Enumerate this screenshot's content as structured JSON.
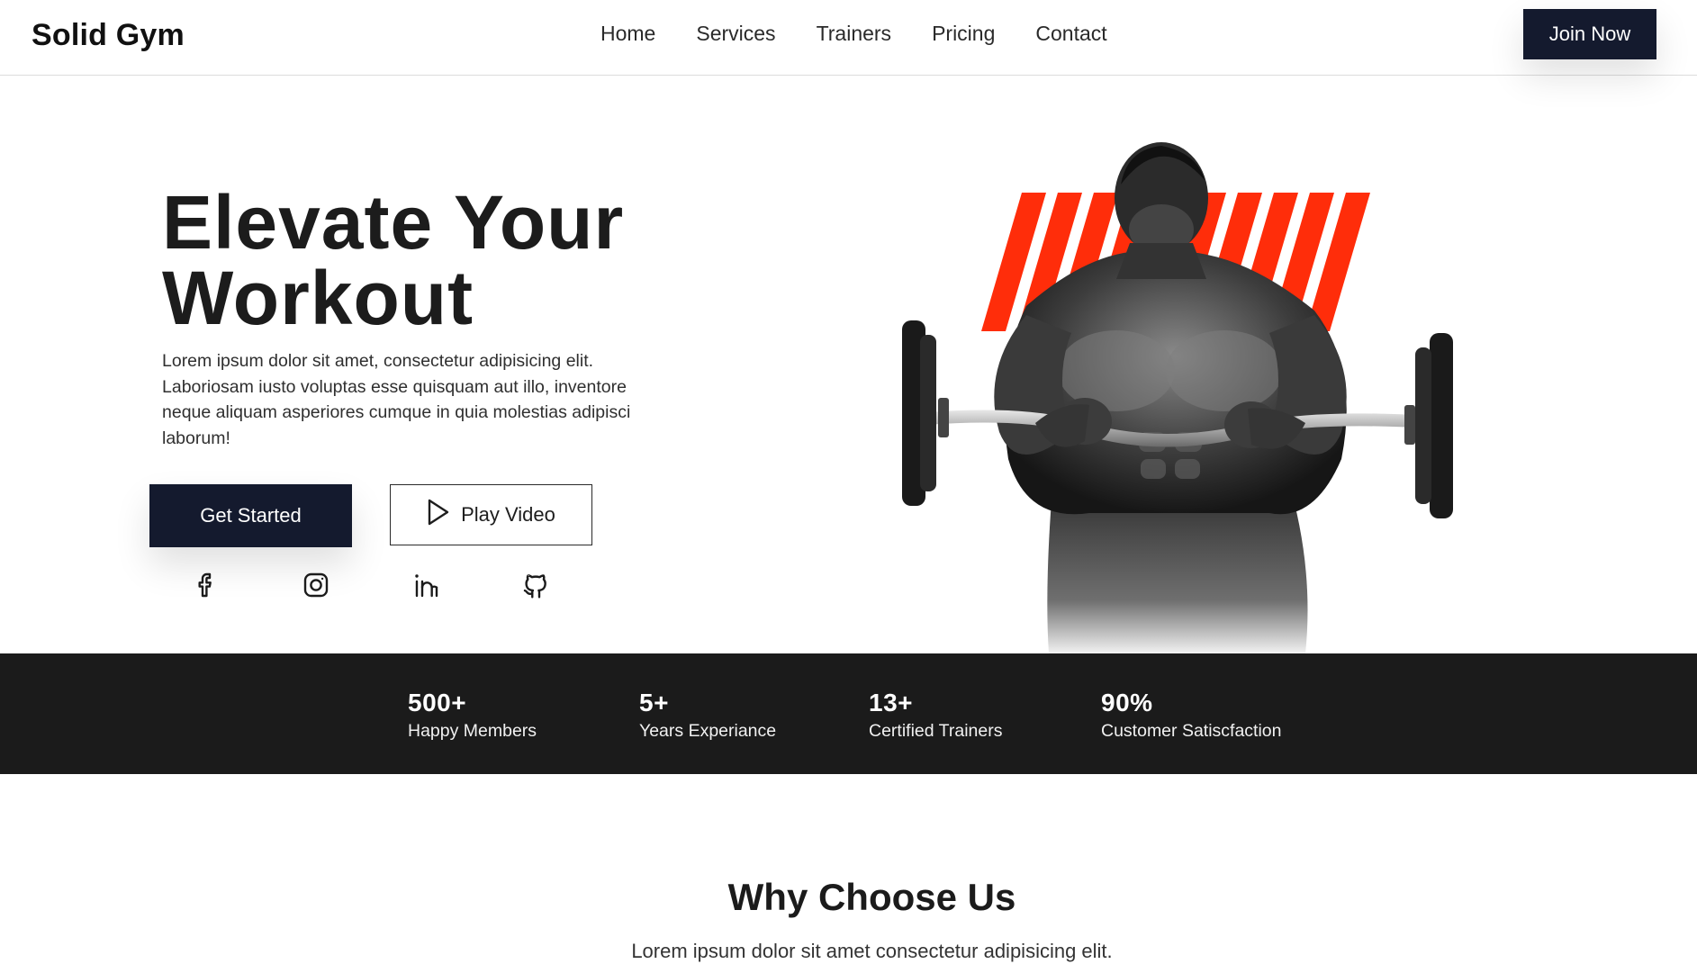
{
  "header": {
    "logo": "Solid Gym",
    "nav": [
      "Home",
      "Services",
      "Trainers",
      "Pricing",
      "Contact"
    ],
    "join_label": "Join Now"
  },
  "hero": {
    "title_line1": "Elevate Your",
    "title_line2": "Workout",
    "description": "Lorem ipsum dolor sit amet, consectetur adipisicing elit. Laboriosam iusto voluptas esse quisquam aut illo, inventore neque aliquam asperiores cumque in quia molestias adipisci laborum!",
    "primary_button": "Get Started",
    "secondary_button": "Play Video",
    "socials": [
      "facebook-icon",
      "instagram-icon",
      "linkedin-icon",
      "github-icon"
    ],
    "accent_color": "#ff2d0a"
  },
  "stats": [
    {
      "value": "500+",
      "label": "Happy Members"
    },
    {
      "value": "5+",
      "label": "Years Experiance"
    },
    {
      "value": "13+",
      "label": "Certified Trainers"
    },
    {
      "value": "90%",
      "label": "Customer Satiscfaction"
    }
  ],
  "why": {
    "title": "Why Choose Us",
    "text": "Lorem ipsum dolor sit amet consectetur adipisicing elit."
  },
  "colors": {
    "dark_navy": "#141a2e",
    "stats_bg": "#1b1b1b"
  }
}
